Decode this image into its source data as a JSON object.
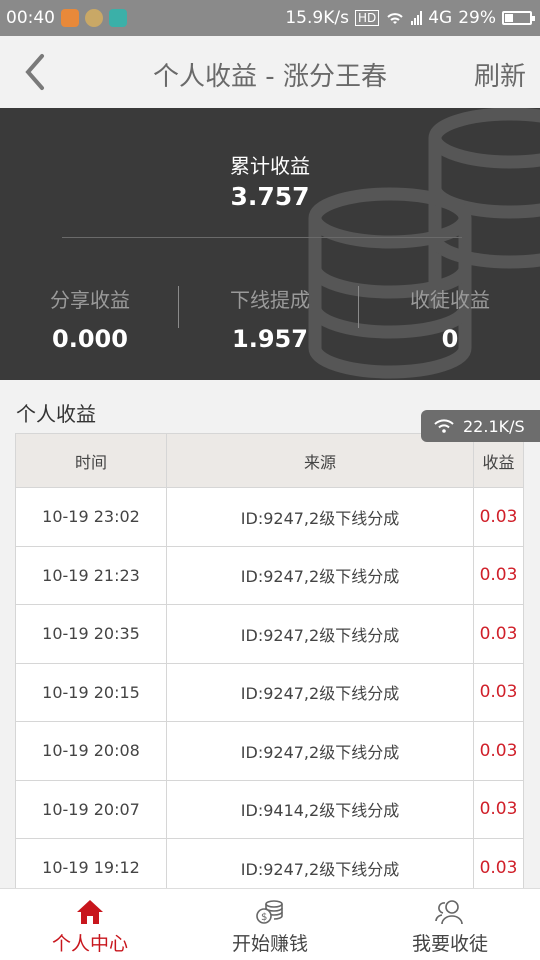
{
  "status_bar": {
    "time": "00:40",
    "speed": "15.9K/s",
    "hd": "HD",
    "network": "4G",
    "battery_pct": "29%",
    "battery_level": 0.29
  },
  "header": {
    "title": "个人收益 - 涨分王春",
    "refresh_label": "刷新"
  },
  "summary": {
    "total_label": "累计收益",
    "total_value": "3.757",
    "stats": [
      {
        "label": "分享收益",
        "value": "0.000"
      },
      {
        "label": "下线提成",
        "value": "1.957"
      },
      {
        "label": "收徒收益",
        "value": "0"
      }
    ]
  },
  "section": {
    "title": "个人收益"
  },
  "speed_overlay": "22.1K/S",
  "table": {
    "headers": [
      "时间",
      "来源",
      "收益"
    ],
    "rows": [
      {
        "time": "10-19 23:02",
        "source": "ID:9247,2级下线分成",
        "amount": "0.03"
      },
      {
        "time": "10-19 21:23",
        "source": "ID:9247,2级下线分成",
        "amount": "0.03"
      },
      {
        "time": "10-19 20:35",
        "source": "ID:9247,2级下线分成",
        "amount": "0.03"
      },
      {
        "time": "10-19 20:15",
        "source": "ID:9247,2级下线分成",
        "amount": "0.03"
      },
      {
        "time": "10-19 20:08",
        "source": "ID:9247,2级下线分成",
        "amount": "0.03"
      },
      {
        "time": "10-19 20:07",
        "source": "ID:9414,2级下线分成",
        "amount": "0.03"
      },
      {
        "time": "10-19 19:12",
        "source": "ID:9247,2级下线分成",
        "amount": "0.03"
      }
    ]
  },
  "nav": {
    "items": [
      {
        "label": "个人中心",
        "icon": "home-icon",
        "active": true
      },
      {
        "label": "开始赚钱",
        "icon": "coins-icon",
        "active": false
      },
      {
        "label": "我要收徒",
        "icon": "users-icon",
        "active": false
      }
    ]
  },
  "colors": {
    "accent": "#c8161d",
    "panel_bg": "#3a3a3a",
    "amount": "#d0202a"
  }
}
